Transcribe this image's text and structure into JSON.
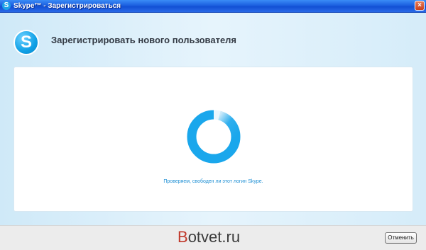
{
  "window": {
    "title": "Skype™ - Зарегистрироваться",
    "close_glyph": "×",
    "app_icon": "skype-logo-icon"
  },
  "header": {
    "logo_glyph": "S",
    "title": "Зарегистрировать нового пользователя"
  },
  "main": {
    "spinner_icon": "loading-spinner-icon",
    "status_text": "Проверяем, свободен ли этот логин Skype."
  },
  "footer": {
    "watermark_b": "B",
    "watermark_rest": "otvet.ru",
    "cancel_label": "Отменить"
  },
  "colors": {
    "accent": "#1d8fd4",
    "spinner": "#1aa7ec",
    "titlebar": "#1c5fe0"
  }
}
